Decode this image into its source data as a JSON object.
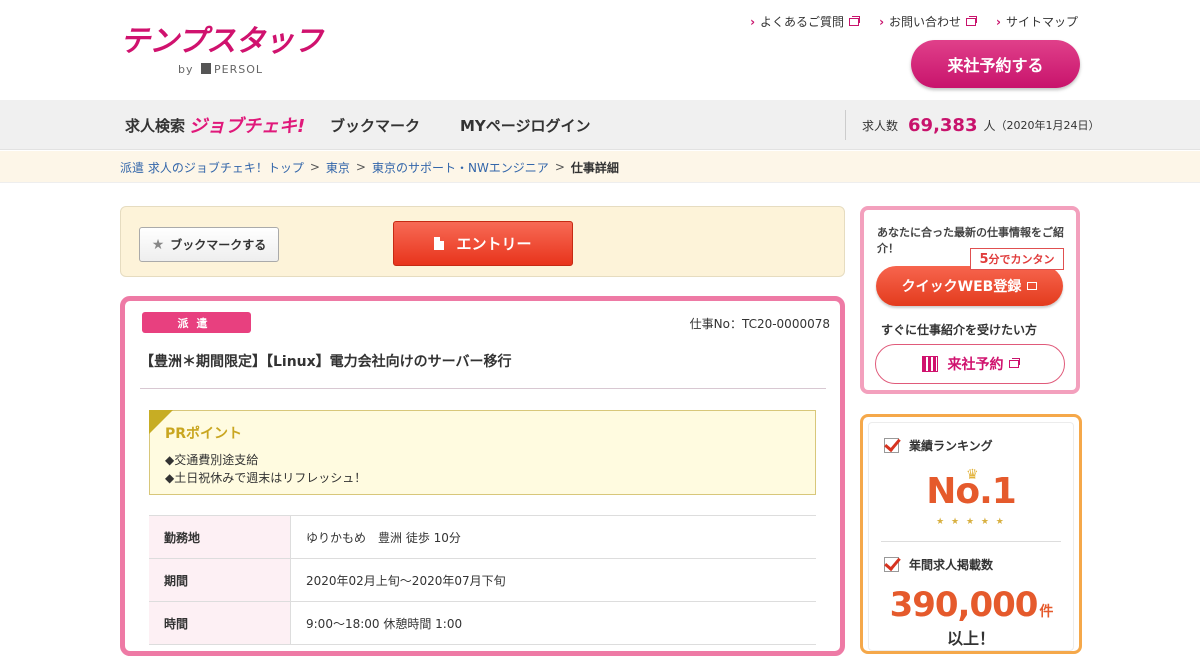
{
  "header": {
    "logo_text": "テンプスタッフ",
    "logo_sub_by": "by",
    "logo_sub_brand": "PERSOL",
    "top_links": [
      "よくあるご質問",
      "お問い合わせ",
      "サイトマップ"
    ],
    "visit_button": "来社予約する"
  },
  "nav": {
    "search_label": "求人検索",
    "search_brand": "ジョブチェキ!",
    "bookmark": "ブックマーク",
    "mypage": "MYページログイン",
    "job_count_label": "求人数",
    "job_count_value": "69,383",
    "job_count_unit": "人",
    "job_count_date": "（2020年1月24日）"
  },
  "breadcrumb": {
    "items": [
      "派遣 求人のジョブチェキ！トップ",
      "東京",
      "東京のサポート・NWエンジニア"
    ],
    "current": "仕事詳細"
  },
  "actions": {
    "bookmark": "ブックマークする",
    "entry": "エントリー"
  },
  "job": {
    "badge": "派遣",
    "job_no": "仕事No：TC20-0000078",
    "title": "【豊洲＊期間限定】【Linux】電力会社向けのサーバー移行",
    "pr_title": "PRポイント",
    "pr_points": [
      "◆交通費別途支給",
      "◆土日祝休みで週末はリフレッシュ！"
    ],
    "details": [
      {
        "label": "勤務地",
        "value": "ゆりかもめ　豊洲 徒歩 10分"
      },
      {
        "label": "期間",
        "value": "2020年02月上旬～2020年07月下旬"
      },
      {
        "label": "時間",
        "value": "9:00～18:00 休憩時間 1:00"
      }
    ]
  },
  "sidebar": {
    "intro": "あなたに合った最新の仕事情報をご紹介！",
    "tag_num": "5",
    "tag_text": "分でカンタン",
    "quick_button": "クイックWEB登録",
    "sub_text": "すぐに仕事紹介を受けたい方",
    "visit_button": "来社予約",
    "ranking_label": "業績ランキング",
    "ranking_value": "No.1",
    "annual_label": "年間求人掲載数",
    "annual_value": "390,000",
    "annual_unit": "件",
    "annual_more": "以上！"
  }
}
